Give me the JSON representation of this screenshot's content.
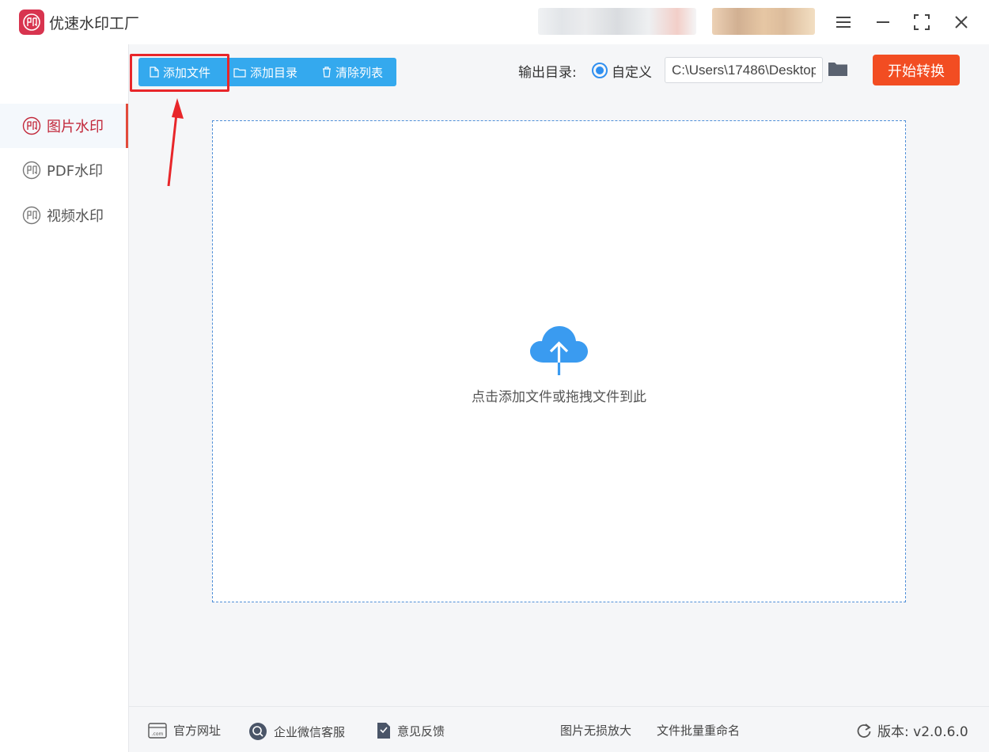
{
  "app": {
    "title": "优速水印工厂",
    "colors": {
      "brand": "#d8344f",
      "primary": "#34a9ee",
      "accent": "#f24d22",
      "active": "#c2283a"
    }
  },
  "toolbar": {
    "add_file": "添加文件",
    "add_folder": "添加目录",
    "clear_list": "清除列表",
    "output_label": "输出目录:",
    "radio_label": "自定义",
    "output_path": "C:\\Users\\17486\\Desktop",
    "start_button": "开始转换"
  },
  "sidebar": {
    "items": [
      {
        "label": "图片水印",
        "icon": "watermark-stamp-icon",
        "active": true
      },
      {
        "label": "PDF水印",
        "icon": "watermark-stamp-icon",
        "active": false
      },
      {
        "label": "视频水印",
        "icon": "watermark-stamp-icon",
        "active": false
      }
    ]
  },
  "dropzone": {
    "icon": "cloud-upload-icon",
    "text": "点击添加文件或拖拽文件到此"
  },
  "footer": {
    "website": "官方网址",
    "wechat_service": "企业微信客服",
    "feedback": "意见反馈",
    "image_enlarge": "图片无损放大",
    "batch_rename": "文件批量重命名",
    "version": "版本:  v2.0.6.0"
  }
}
